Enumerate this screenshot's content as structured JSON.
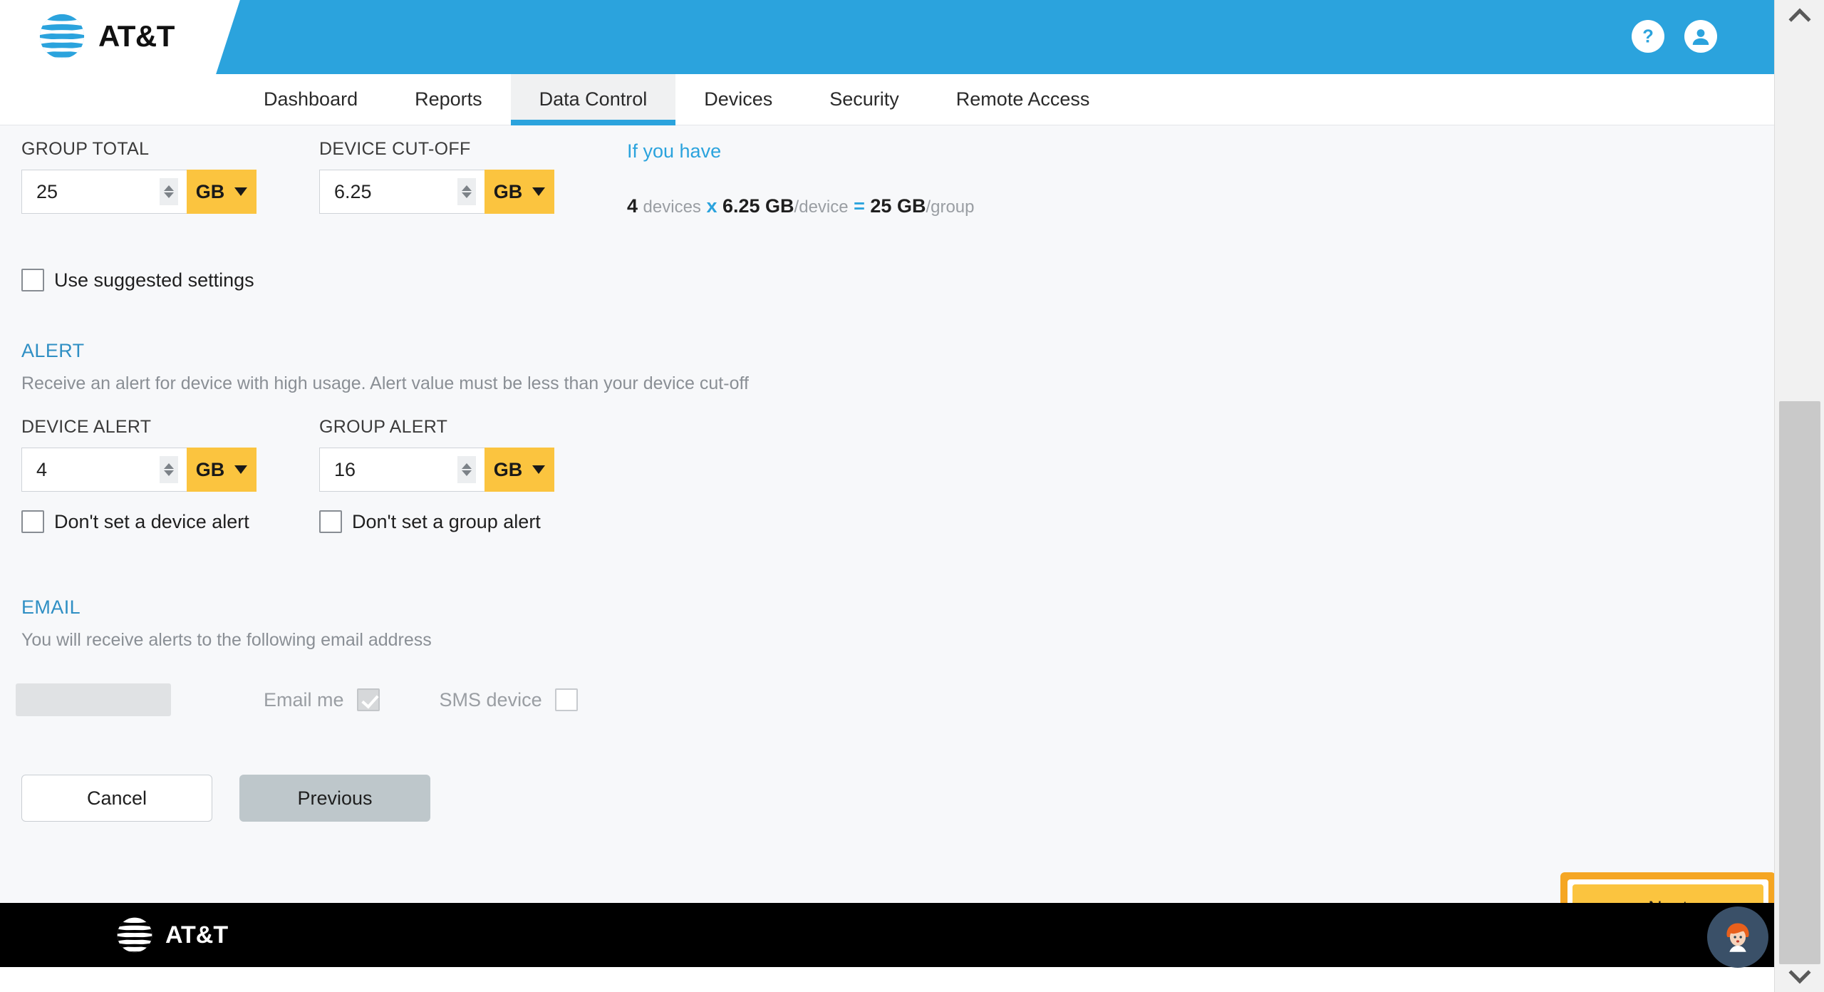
{
  "header": {
    "brand": "AT&T",
    "help_icon": "help-circle-icon",
    "account_icon": "account-circle-icon"
  },
  "nav": {
    "tabs": [
      {
        "label": "Dashboard",
        "active": false
      },
      {
        "label": "Reports",
        "active": false
      },
      {
        "label": "Data Control",
        "active": true
      },
      {
        "label": "Devices",
        "active": false
      },
      {
        "label": "Security",
        "active": false
      },
      {
        "label": "Remote Access",
        "active": false
      }
    ]
  },
  "form": {
    "group_total": {
      "label": "GROUP TOTAL",
      "value": "25",
      "unit": "GB"
    },
    "device_cutoff": {
      "label": "DEVICE CUT-OFF",
      "value": "6.25",
      "unit": "GB"
    },
    "suggested": {
      "label": "Use suggested settings",
      "checked": false
    }
  },
  "calc": {
    "title": "If you have",
    "devices_count": "4",
    "devices_word": "devices",
    "times": "x",
    "per_device_value": "6.25 GB",
    "per_device_unit": "/device",
    "equals": "=",
    "total_value": "25 GB",
    "total_unit": "/group"
  },
  "alert": {
    "title": "ALERT",
    "description": "Receive an alert for device with high usage. Alert value must be less than your device cut-off",
    "device_alert": {
      "label": "DEVICE ALERT",
      "value": "4",
      "unit": "GB",
      "checkbox_label": "Don't set a device alert",
      "checked": false
    },
    "group_alert": {
      "label": "GROUP ALERT",
      "value": "16",
      "unit": "GB",
      "checkbox_label": "Don't set a group alert",
      "checked": false
    }
  },
  "email": {
    "title": "EMAIL",
    "description": "You will receive alerts to the following email address",
    "address_value": "",
    "email_me_label": "Email me",
    "email_me_checked": true,
    "sms_label": "SMS device",
    "sms_checked": false
  },
  "actions": {
    "cancel": "Cancel",
    "previous": "Previous",
    "next": "Next"
  },
  "footer": {
    "brand": "AT&T"
  },
  "chat": {
    "icon": "chat-agent-avatar-icon"
  },
  "colors": {
    "brand_blue": "#2ba3dd",
    "accent_yellow": "#fbc43f",
    "highlight_orange": "#f5a623",
    "link_blue": "#2f8fc4",
    "content_bg": "#f7f8fa"
  }
}
